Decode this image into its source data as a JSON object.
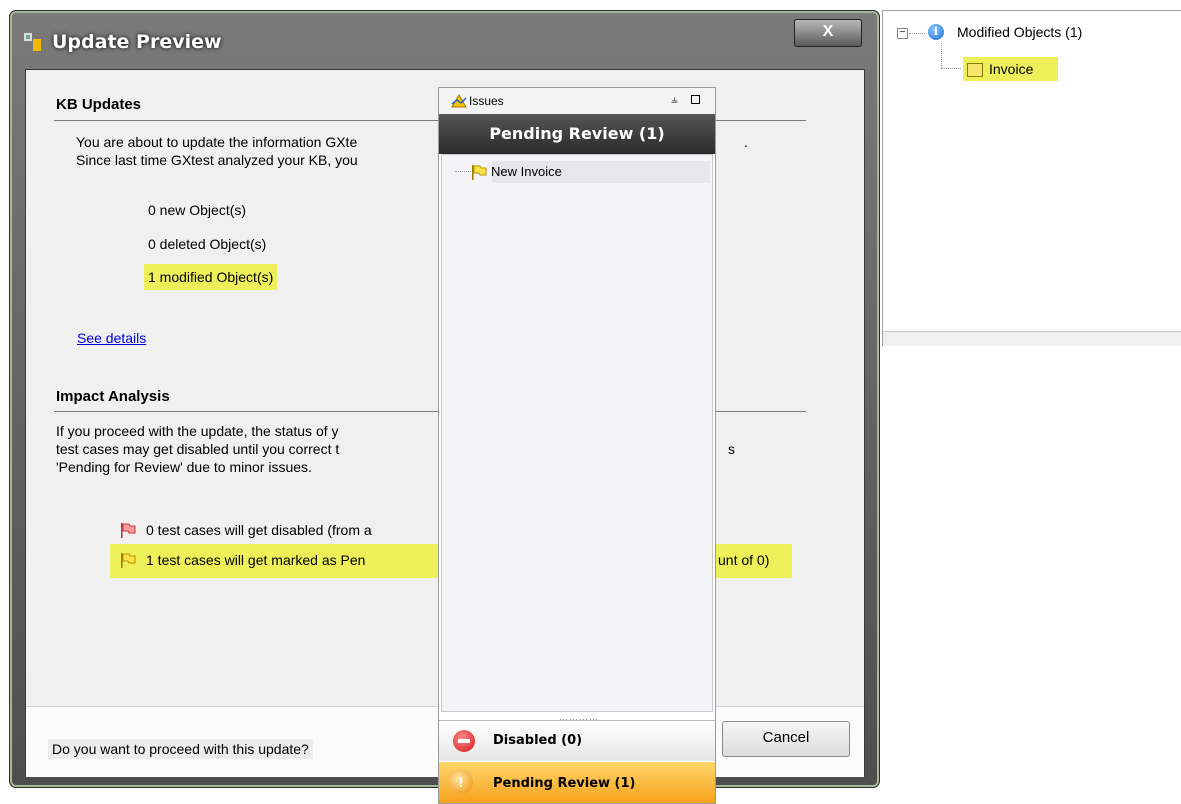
{
  "dialog": {
    "title": "Update Preview",
    "close_label": "X",
    "kb_updates": {
      "heading": "KB Updates",
      "line1": "You are about to update the information GXte",
      "line2": "Since last time GXtest analyzed your KB, you",
      "line1_tail": ".",
      "new_objects": "0 new Object(s)",
      "deleted_objects": "0 deleted Object(s)",
      "modified_objects": "1 modified Object(s)",
      "see_details": "See details"
    },
    "impact": {
      "heading": "Impact Analysis",
      "line1": "If you proceed with the update, the status of y",
      "line2": "test cases may get disabled until you correct t",
      "line2_tail": "s",
      "line3": "'Pending for Review' due to minor issues.",
      "disabled_text": "0 test cases will get disabled (from a",
      "pending_text": "1 test cases will get marked as Pen",
      "pending_tail": "unt of 0)"
    },
    "question": "Do you want to proceed with this update?",
    "cancel_label": "Cancel"
  },
  "issues_panel": {
    "title": "Issues",
    "pin_glyph": "⫨",
    "section_header": "Pending Review (1)",
    "tree_item": "New Invoice",
    "grip": "…………",
    "disabled_label": "Disabled (0)",
    "pending_label": "Pending Review (1)",
    "warn_glyph": "!"
  },
  "side_tree": {
    "collapse_glyph": "−",
    "info_glyph": "i",
    "root_label": "Modified Objects (1)",
    "child_label": "Invoice"
  },
  "colors": {
    "highlight": "#eef05a",
    "pending_accent": "#f4a21c",
    "disabled_accent": "#d41818"
  }
}
